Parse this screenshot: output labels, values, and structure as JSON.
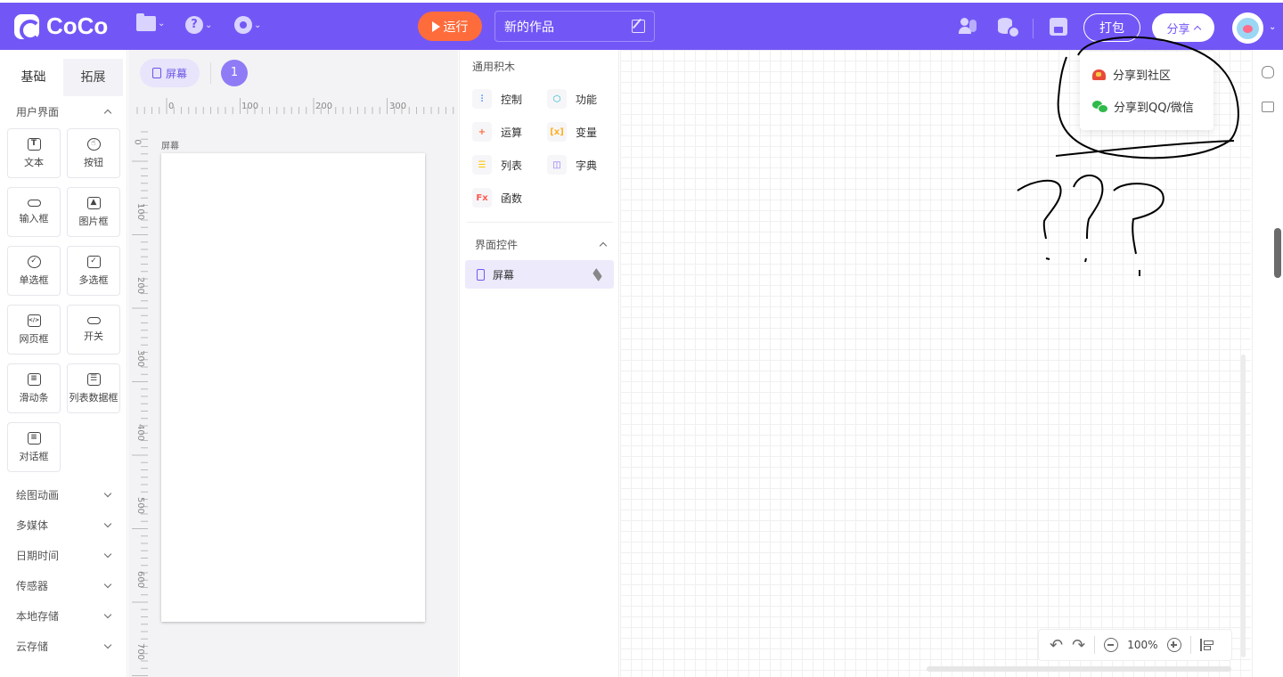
{
  "app": {
    "logo_text": "CoCo"
  },
  "toolbar": {
    "run_label": "运行",
    "project_title": "新的作品",
    "pack_label": "打包",
    "share_label": "分享"
  },
  "share_menu": {
    "items": [
      {
        "label": "分享到社区"
      },
      {
        "label": "分享到QQ/微信"
      }
    ]
  },
  "left_panel": {
    "tabs": [
      {
        "label": "基础"
      },
      {
        "label": "拓展"
      }
    ],
    "ui_section": "用户界面",
    "components": [
      {
        "label": "文本",
        "icon": "text-icon",
        "glyph": "T"
      },
      {
        "label": "按钮",
        "icon": "button-icon",
        "glyph": "☝"
      },
      {
        "label": "输入框",
        "icon": "input-icon",
        "glyph": "I"
      },
      {
        "label": "图片框",
        "icon": "image-icon",
        "glyph": "▲"
      },
      {
        "label": "单选框",
        "icon": "radio-icon",
        "glyph": "✓"
      },
      {
        "label": "多选框",
        "icon": "checkbox-icon",
        "glyph": "✓"
      },
      {
        "label": "网页框",
        "icon": "webview-icon",
        "glyph": "</>"
      },
      {
        "label": "开关",
        "icon": "switch-icon",
        "glyph": "●"
      },
      {
        "label": "滑动条",
        "icon": "slider-icon",
        "glyph": "≡"
      },
      {
        "label": "列表数据框",
        "icon": "list-data-icon",
        "glyph": "☰"
      },
      {
        "label": "对话框",
        "icon": "dialog-icon",
        "glyph": "≡"
      }
    ],
    "categories": [
      {
        "label": "绘图动画"
      },
      {
        "label": "多媒体"
      },
      {
        "label": "日期时间"
      },
      {
        "label": "传感器"
      },
      {
        "label": "本地存储"
      },
      {
        "label": "云存储"
      }
    ]
  },
  "canvas": {
    "screen_tab_label": "屏幕",
    "page_number": "1",
    "screen_label": "屏幕",
    "ruler_h": [
      "0",
      "100",
      "200",
      "300"
    ],
    "ruler_v": [
      "0",
      "100",
      "200",
      "300",
      "400",
      "500",
      "600",
      "700"
    ]
  },
  "blocks_panel": {
    "general_title": "通用积木",
    "items": [
      {
        "label": "控制",
        "icon": "control-icon",
        "glyph": "⫶",
        "color": "#2f8cff"
      },
      {
        "label": "功能",
        "icon": "function-icon",
        "glyph": "⬡",
        "color": "#1cb5c4"
      },
      {
        "label": "运算",
        "icon": "operator-icon",
        "glyph": "+",
        "color": "#ff6b3d"
      },
      {
        "label": "变量",
        "icon": "variable-icon",
        "glyph": "[x]",
        "color": "#ffb020"
      },
      {
        "label": "列表",
        "icon": "list-icon",
        "glyph": "☰",
        "color": "#ffc400"
      },
      {
        "label": "字典",
        "icon": "dict-icon",
        "glyph": "◫",
        "color": "#8a6cf5"
      },
      {
        "label": "函数",
        "icon": "fx-icon",
        "glyph": "Fx",
        "color": "#ff5a4f"
      }
    ],
    "controls_title": "界面控件",
    "screen_row_label": "屏幕"
  },
  "stage": {
    "zoom": "100%"
  }
}
